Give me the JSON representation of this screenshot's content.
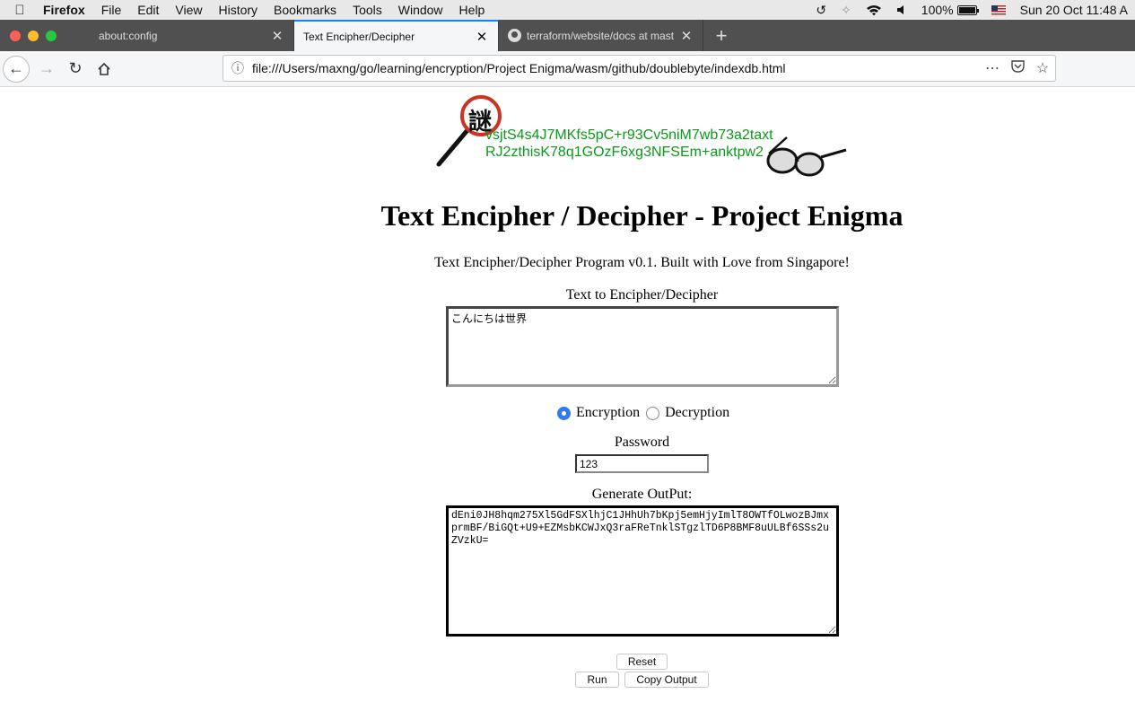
{
  "menubar": {
    "app_name": "Firefox",
    "items": [
      "File",
      "Edit",
      "View",
      "History",
      "Bookmarks",
      "Tools",
      "Window",
      "Help"
    ],
    "battery": "100%",
    "battery_level": 1.0,
    "datetime": "Sun 20 Oct  11:48 A"
  },
  "tabs": [
    {
      "label": "about:config",
      "active": false
    },
    {
      "label": "Text Encipher/Decipher",
      "active": true
    },
    {
      "label": "terraform/website/docs at mast",
      "active": false
    }
  ],
  "navbar": {
    "url": "file:///Users/maxng/go/learning/encryption/Project Enigma/wasm/github/doublebyte/indexdb.html"
  },
  "page": {
    "logo_kanji": "謎",
    "logo_line1": "vsjtS4s4J7MKfs5pC+r93Cv5niM7wb73a2taxt",
    "logo_line2": "RJ2zthisK78q1GOzF6xg3NFSEm+anktpw2",
    "title": "Text Encipher / Decipher - Project Enigma",
    "subtitle": "Text Encipher/Decipher Program v0.1. Built with Love from Singapore!",
    "input_label": "Text to Encipher/Decipher",
    "input_value": "こんにちは世界",
    "radio_encrypt": "Encryption",
    "radio_decrypt": "Decryption",
    "password_label": "Password",
    "password_value": "123",
    "output_label": "Generate OutPut:",
    "output_value": "dEni0JH8hqm275Xl5GdFSXlhjC1JHhUh7bKpj5emHjyImlT8OWTfOLwozBJmxprmBF/BiGQt+U9+EZMsbKCWJxQ3raFReTnklSTgzlTD6P8BMF8uULBf6SSs2uZVzkU=",
    "reset_label": "Reset",
    "run_label": "Run",
    "copy_label": "Copy Output"
  }
}
